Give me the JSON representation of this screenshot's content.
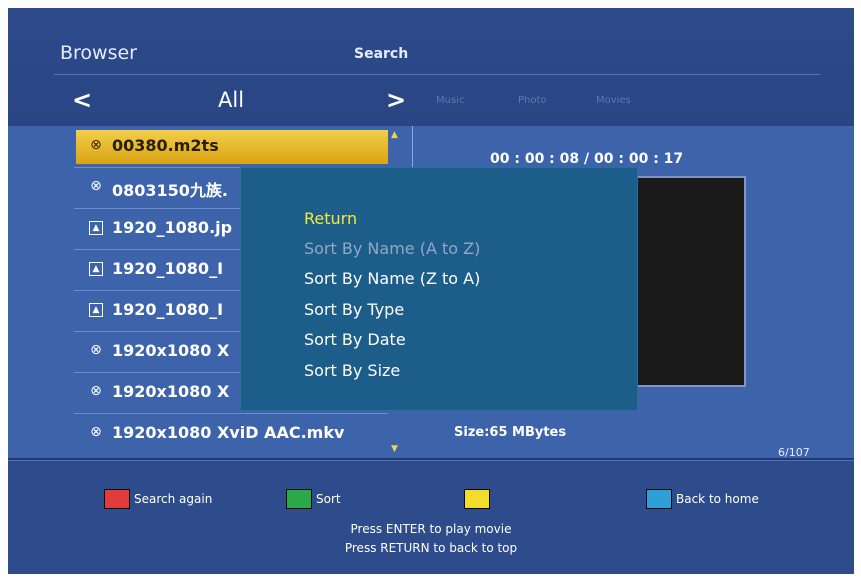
{
  "header": {
    "title": "Browser",
    "search_label": "Search",
    "category": "All",
    "nav_prev": "<",
    "nav_next": ">",
    "media_tabs": [
      "Music",
      "Photo",
      "Movies"
    ]
  },
  "files": [
    {
      "icon": "video-icon",
      "name": "00380.m2ts",
      "selected": true
    },
    {
      "icon": "video-icon",
      "name": "0803150九族."
    },
    {
      "icon": "image-icon",
      "name": "1920_1080.jp"
    },
    {
      "icon": "image-icon",
      "name": "1920_1080_I"
    },
    {
      "icon": "image-icon",
      "name": "1920_1080_I"
    },
    {
      "icon": "video-icon",
      "name": "1920x1080 X"
    },
    {
      "icon": "video-icon",
      "name": "1920x1080 X"
    },
    {
      "icon": "video-icon",
      "name": "1920x1080 XviD AAC.mkv"
    }
  ],
  "details": {
    "time": "00 : 00 : 08 / 00 : 00 : 17",
    "size": "Size:65 MBytes",
    "count": "6/107"
  },
  "sort_menu": {
    "items": [
      {
        "label": "Return",
        "state": "highlighted"
      },
      {
        "label": "Sort By Name (A to Z)",
        "state": "disabled"
      },
      {
        "label": "Sort By Name (Z to A)",
        "state": "normal"
      },
      {
        "label": "Sort By Type",
        "state": "normal"
      },
      {
        "label": "Sort By Date",
        "state": "normal"
      },
      {
        "label": "Sort By Size",
        "state": "normal"
      }
    ],
    "colors": {
      "highlighted": "#f5ea3a",
      "disabled": "#93a7c6",
      "normal": "#ffffff"
    }
  },
  "footer": {
    "buttons": [
      {
        "color": "red",
        "hex": "#e23b3b",
        "label": "Search again"
      },
      {
        "color": "green",
        "hex": "#2aa84a",
        "label": "Sort"
      },
      {
        "color": "yellow",
        "hex": "#f2de2a",
        "label": ""
      },
      {
        "color": "blue",
        "hex": "#2f9fd8",
        "label": "Back to home"
      }
    ],
    "hints": [
      "Press ENTER to play movie",
      "Press RETURN to back to top"
    ]
  }
}
